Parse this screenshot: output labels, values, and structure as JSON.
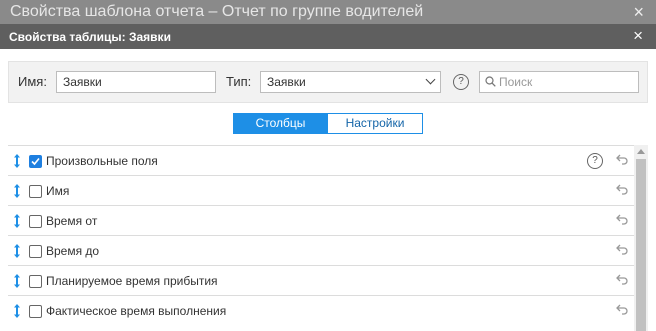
{
  "outer": {
    "title": "Свойства шаблона отчета – Отчет по группе водителей",
    "close_icon": "×"
  },
  "dialog": {
    "title": "Свойства таблицы: Заявки",
    "close_icon": "×"
  },
  "form": {
    "name_label": "Имя:",
    "name_value": "Заявки",
    "type_label": "Тип:",
    "type_value": "Заявки",
    "help_icon": "?",
    "search_placeholder": "Поиск"
  },
  "tabs": {
    "columns": "Столбцы",
    "settings": "Настройки",
    "active": "columns"
  },
  "colors": {
    "accent": "#1e8fe6",
    "title_bar": "#5f5f5f",
    "outer_bar": "#8a8a8a",
    "panel": "#f2f2f2"
  },
  "rows": [
    {
      "label": "Произвольные поля",
      "checked": true,
      "help": true
    },
    {
      "label": "Имя",
      "checked": false,
      "help": false
    },
    {
      "label": "Время от",
      "checked": false,
      "help": false
    },
    {
      "label": "Время до",
      "checked": false,
      "help": false
    },
    {
      "label": "Планируемое время прибытия",
      "checked": false,
      "help": false
    },
    {
      "label": "Фактическое время выполнения",
      "checked": false,
      "help": false
    }
  ],
  "icons": {
    "drag": "drag-vertical-icon",
    "reset": "undo-icon",
    "search": "search-icon",
    "help": "help-circle-icon"
  }
}
